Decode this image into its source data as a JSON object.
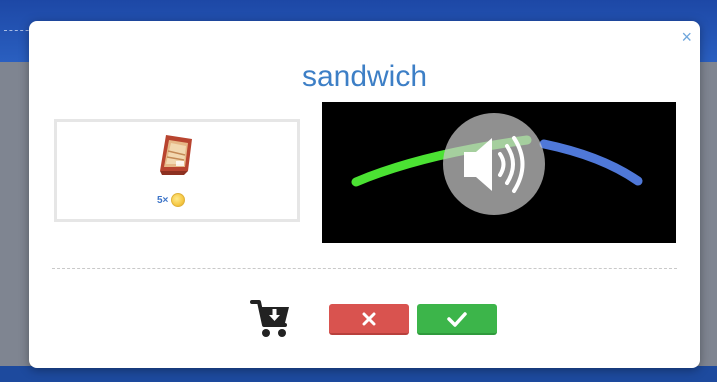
{
  "dialog": {
    "title": "sandwich",
    "close_glyph": "×",
    "item": {
      "icon": "sandwich-icon",
      "price_count": "5×",
      "currency_icon": "coin-icon"
    },
    "audio": {
      "speaker_icon": "speaker-icon",
      "curve_colors": [
        "#4be233",
        "#4f78d8"
      ]
    },
    "actions": {
      "cart_icon": "cart-download-icon",
      "cancel_icon": "x-icon",
      "confirm_icon": "check-icon"
    }
  },
  "colors": {
    "title": "#3d7fc6",
    "cancel": "#d9534f",
    "confirm": "#3cb54a",
    "background_blue": "#2d58a8"
  }
}
